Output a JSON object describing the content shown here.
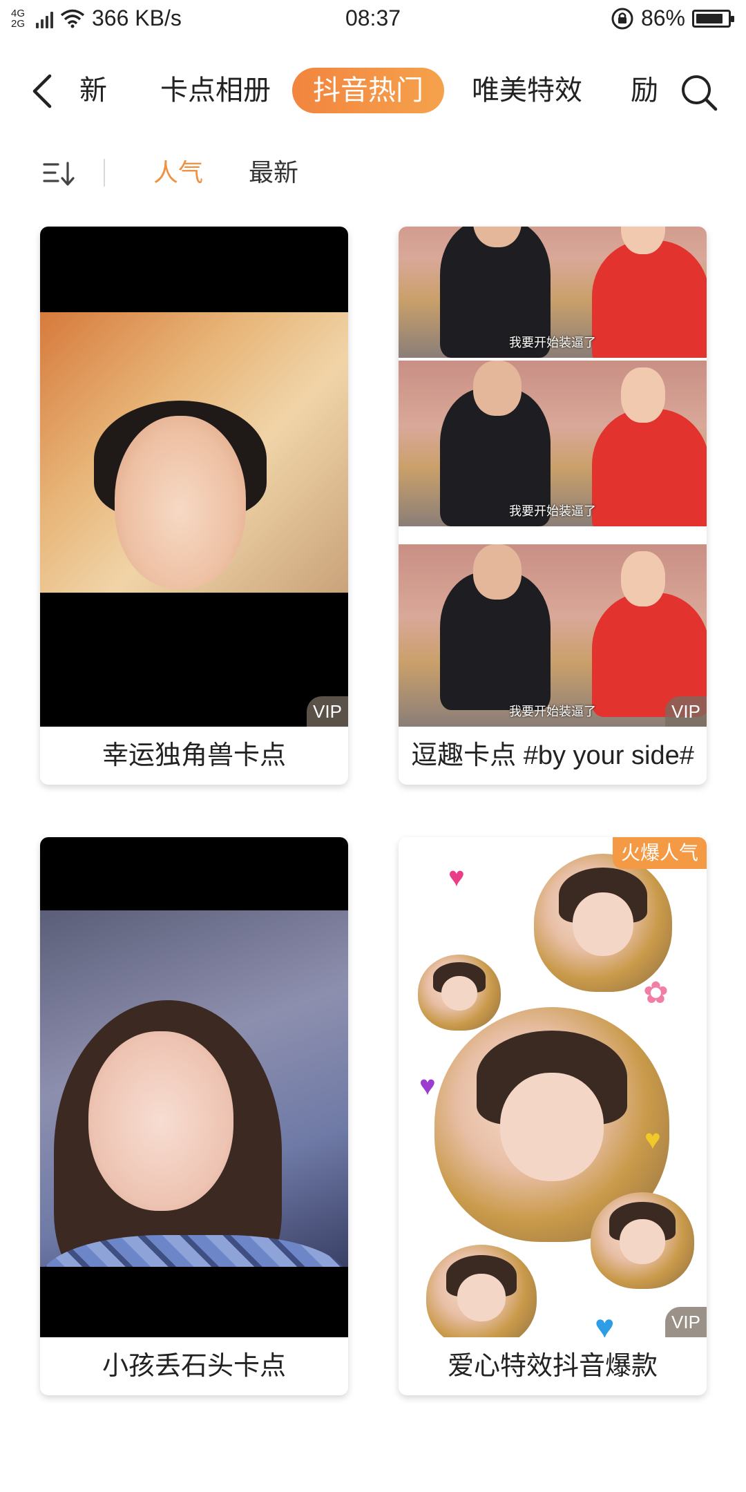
{
  "status_bar": {
    "network_type": "4G 2G",
    "speed": "366 KB/s",
    "time": "08:37",
    "battery_percent": "86%",
    "battery_level": 0.86
  },
  "nav": {
    "tabs": [
      {
        "label": "新"
      },
      {
        "label": "卡点相册"
      },
      {
        "label": "抖音热门",
        "active": true
      },
      {
        "label": "唯美特效"
      },
      {
        "label": "励"
      }
    ],
    "accent_color": "#f2853f"
  },
  "sort_bar": {
    "options": [
      "人气",
      "最新"
    ],
    "selected": "人气",
    "selected_color": "#ee9140"
  },
  "videos": [
    {
      "title": "幸运独角兽卡点",
      "badge": "VIP"
    },
    {
      "title": "逗趣卡点 #by your side#",
      "badge": "VIP",
      "subtitle_in_frame": "我要开始装逼了"
    },
    {
      "title": "小孩丢石头卡点"
    },
    {
      "title": "爱心特效抖音爆款",
      "badge": "VIP",
      "top_badge": "火爆人气"
    }
  ]
}
